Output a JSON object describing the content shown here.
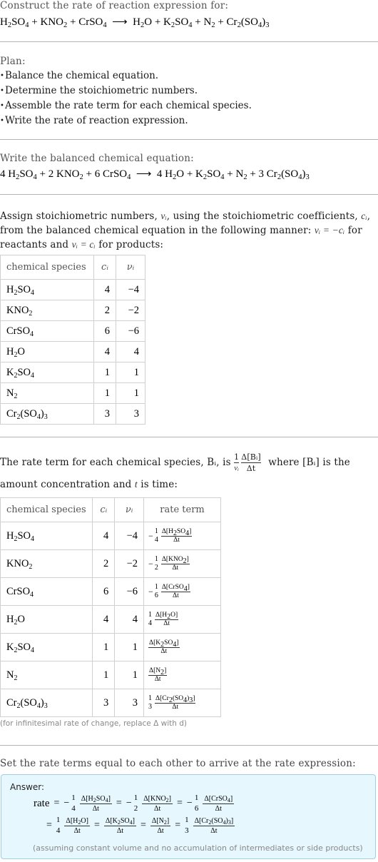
{
  "intro": {
    "label": "Construct the rate of reaction expression for:",
    "equation": "H₂SO₄ + KNO₂ + CrSO₄ ⟶ H₂O + K₂SO₄ + N₂ + Cr₂(SO₄)₃"
  },
  "plan": {
    "label": "Plan:",
    "items": [
      "Balance the chemical equation.",
      "Determine the stoichiometric numbers.",
      "Assemble the rate term for each chemical species.",
      "Write the rate of reaction expression."
    ]
  },
  "balanced": {
    "label": "Write the balanced chemical equation:",
    "equation": "4 H₂SO₄ + 2 KNO₂ + 6 CrSO₄ ⟶ 4 H₂O + K₂SO₄ + N₂ + 3 Cr₂(SO₄)₃"
  },
  "stoich": {
    "text_1": "Assign stoichiometric numbers, ",
    "nu_i": "νᵢ",
    "text_2": ", using the stoichiometric coefficients, ",
    "c_i": "cᵢ",
    "text_3": ", from the balanced chemical equation in the following manner: ",
    "rule_reactants": "νᵢ = −cᵢ",
    "text_4": " for reactants and ",
    "rule_products": "νᵢ = cᵢ",
    "text_5": " for products:",
    "headers": [
      "chemical species",
      "cᵢ",
      "νᵢ"
    ],
    "rows": [
      {
        "species": "H₂SO₄",
        "c": "4",
        "nu": "−4"
      },
      {
        "species": "KNO₂",
        "c": "2",
        "nu": "−2"
      },
      {
        "species": "CrSO₄",
        "c": "6",
        "nu": "−6"
      },
      {
        "species": "H₂O",
        "c": "4",
        "nu": "4"
      },
      {
        "species": "K₂SO₄",
        "c": "1",
        "nu": "1"
      },
      {
        "species": "N₂",
        "c": "1",
        "nu": "1"
      },
      {
        "species": "Cr₂(SO₄)₃",
        "c": "3",
        "nu": "3"
      }
    ]
  },
  "rate_terms": {
    "text_1": "The rate term for each chemical species, ",
    "b_i": "Bᵢ",
    "text_2": ", is ",
    "formula_num_coef": "1",
    "formula_den_coef": "νᵢ",
    "formula_num": "Δ[Bᵢ]",
    "formula_den": "Δt",
    "text_3": " where ",
    "conc": "[Bᵢ]",
    "text_4": " is the amount concentration and ",
    "t": "t",
    "text_5": " is time:",
    "headers": [
      "chemical species",
      "cᵢ",
      "νᵢ",
      "rate term"
    ],
    "rows": [
      {
        "species": "H₂SO₄",
        "c": "4",
        "nu": "−4",
        "sign": "−",
        "coef_num": "1",
        "coef_den": "4",
        "num": "Δ[H₂SO₄]",
        "den": "Δt"
      },
      {
        "species": "KNO₂",
        "c": "2",
        "nu": "−2",
        "sign": "−",
        "coef_num": "1",
        "coef_den": "2",
        "num": "Δ[KNO₂]",
        "den": "Δt"
      },
      {
        "species": "CrSO₄",
        "c": "6",
        "nu": "−6",
        "sign": "−",
        "coef_num": "1",
        "coef_den": "6",
        "num": "Δ[CrSO₄]",
        "den": "Δt"
      },
      {
        "species": "H₂O",
        "c": "4",
        "nu": "4",
        "sign": "",
        "coef_num": "1",
        "coef_den": "4",
        "num": "Δ[H₂O]",
        "den": "Δt"
      },
      {
        "species": "K₂SO₄",
        "c": "1",
        "nu": "1",
        "sign": "",
        "coef_num": "",
        "coef_den": "",
        "num": "Δ[K₂SO₄]",
        "den": "Δt"
      },
      {
        "species": "N₂",
        "c": "1",
        "nu": "1",
        "sign": "",
        "coef_num": "",
        "coef_den": "",
        "num": "Δ[N₂]",
        "den": "Δt"
      },
      {
        "species": "Cr₂(SO₄)₃",
        "c": "3",
        "nu": "3",
        "sign": "",
        "coef_num": "1",
        "coef_den": "3",
        "num": "Δ[Cr₂(SO₄)₃]",
        "den": "Δt"
      }
    ],
    "note": "(for infinitesimal rate of change, replace Δ with d)"
  },
  "answer": {
    "intro": "Set the rate terms equal to each other to arrive at the rate expression:",
    "label": "Answer:",
    "rate_word": "rate",
    "equals": "=",
    "note": "(assuming constant volume and no accumulation of intermediates or side products)",
    "colors": {
      "background": "#e6f7fd",
      "border": "#9fcfe0"
    }
  }
}
